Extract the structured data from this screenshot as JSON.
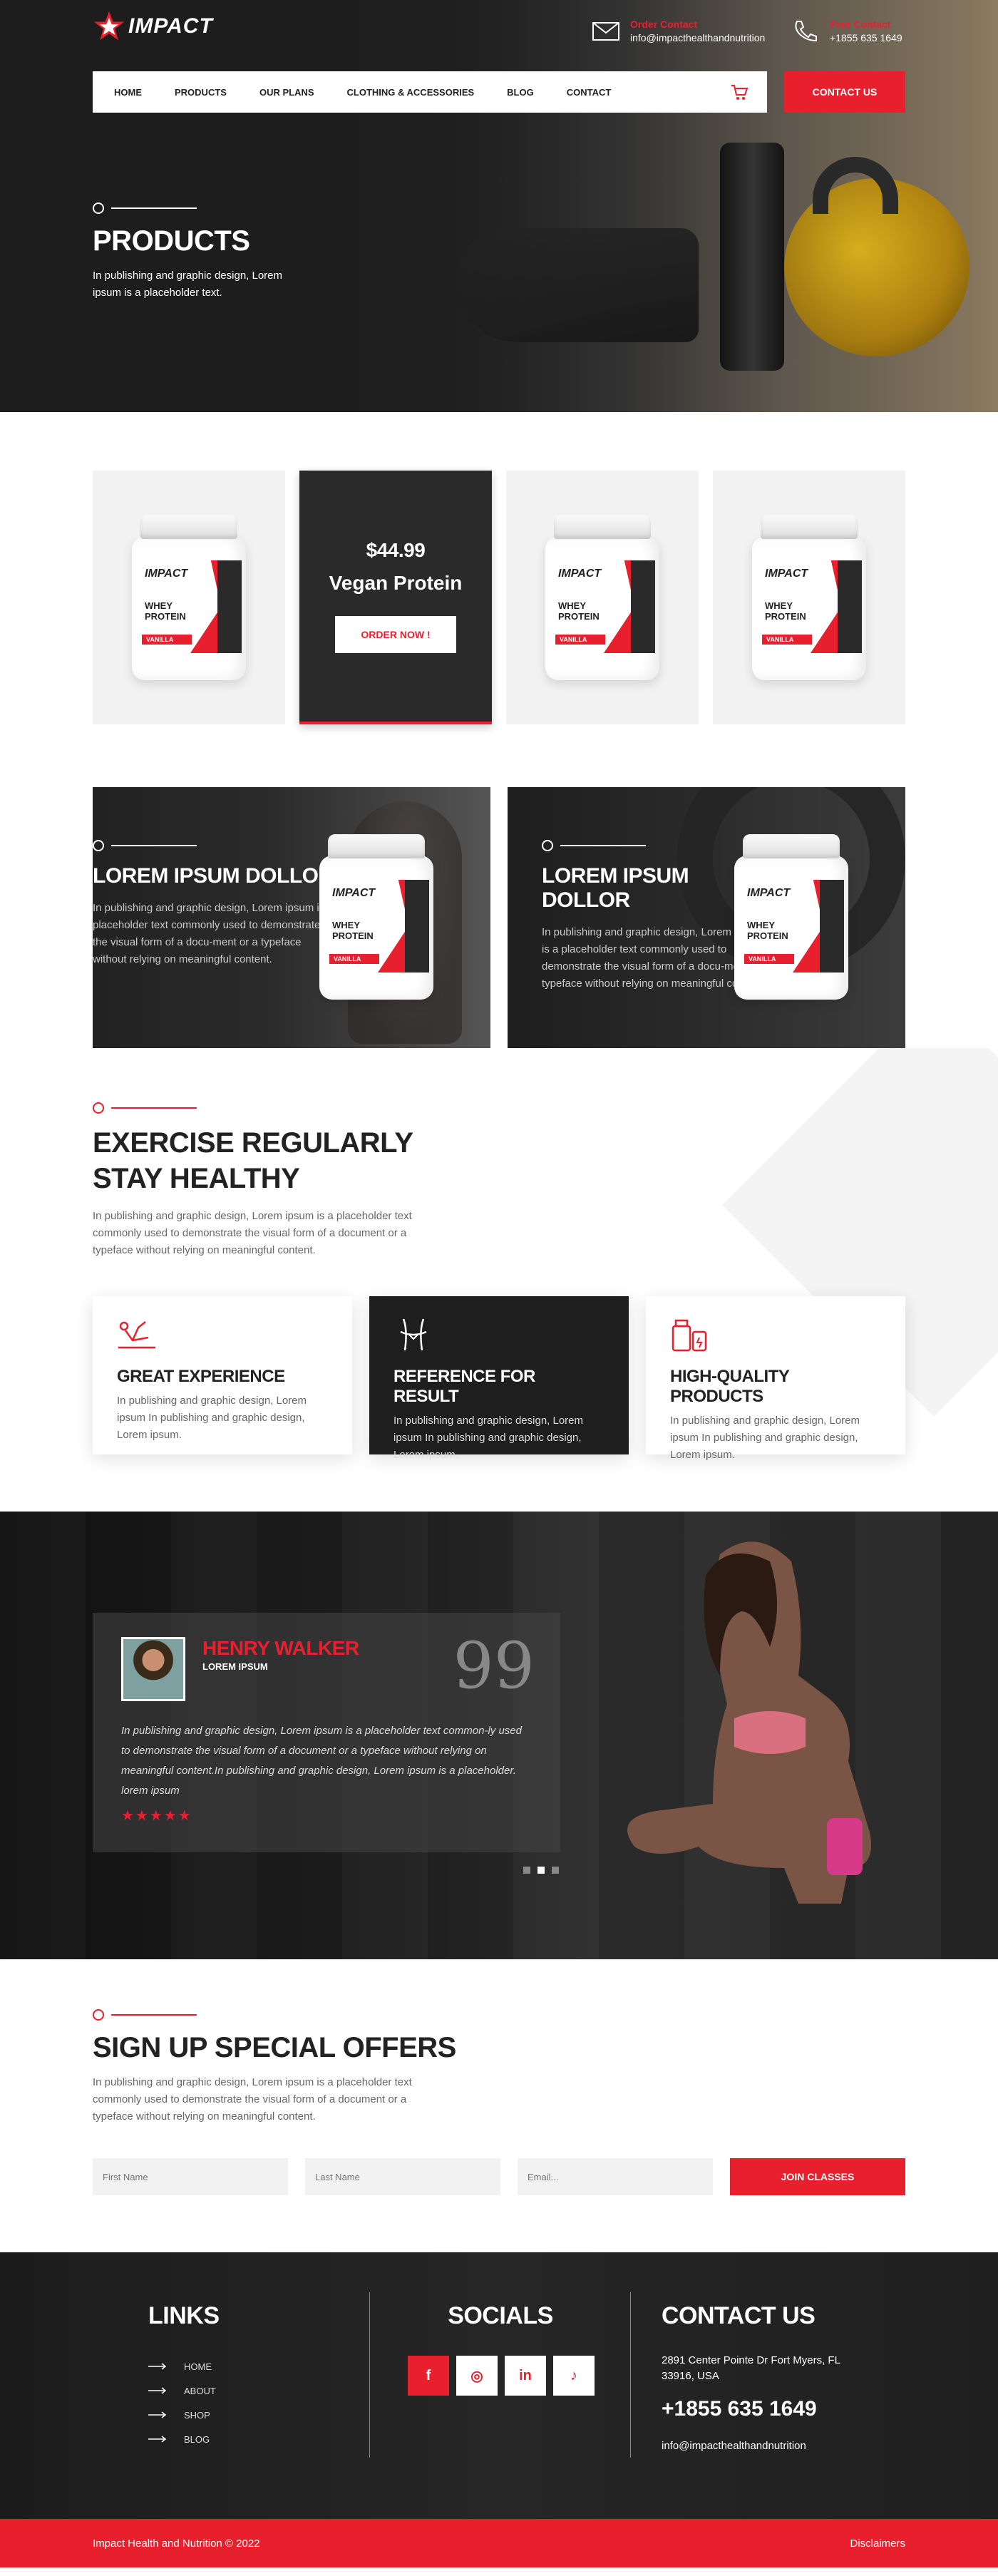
{
  "header": {
    "logo_text": "IMPACT",
    "order_label": "Order Contact",
    "order_email": "info@impacthealthandnutrition",
    "free_label": "Free Contact",
    "free_phone": "+1855 635 1649",
    "nav": [
      "HOME",
      "PRODUCTS",
      "OUR PLANS",
      "CLOTHING & ACCESSORIES",
      "BLOG",
      "CONTACT"
    ],
    "contact_button": "CONTACT US"
  },
  "hero": {
    "title": "PRODUCTS",
    "text": "In publishing and graphic design, Lorem ipsum is a placeholder text."
  },
  "products": {
    "jar_brand": "IMPACT",
    "jar_type": "WHEY PROTEIN",
    "jar_flavor": "VANILLA",
    "featured_price": "$44.99",
    "featured_name": "Vegan Protein",
    "order_button": "ORDER NOW !"
  },
  "features": [
    {
      "title": "LOREM IPSUM DOLLOR",
      "text": "In publishing and graphic design, Lorem ipsum is a placeholder text commonly used to demonstrate the visual form of a docu-ment or a typeface without relying on meaningful content."
    },
    {
      "title": "LOREM IPSUM DOLLOR",
      "text": "In publishing and graphic design, Lorem ipsum is a placeholder text commonly used to demonstrate the visual form of a docu-ment or a typeface without relying on meaningful content."
    }
  ],
  "exercise": {
    "title_line1": "EXERCISE REGULARLY",
    "title_line2": "STAY HEALTHY",
    "text": "In publishing and graphic design, Lorem ipsum is a placeholder text commonly used to demonstrate the visual form of a document or a typeface without relying on meaningful content.",
    "boxes": [
      {
        "icon": "stretching-icon",
        "title": "GREAT EXPERIENCE",
        "text": "In publishing and graphic design, Lorem ipsum In publishing and graphic design, Lorem ipsum."
      },
      {
        "icon": "body-measure-icon",
        "title": "REFERENCE FOR RESULT",
        "text": "In publishing and graphic design, Lorem ipsum In publishing and graphic design, Lorem ipsum."
      },
      {
        "icon": "supplement-icon",
        "title": "HIGH-QUALITY PRODUCTS",
        "text": "In publishing and graphic design, Lorem ipsum In publishing and graphic design, Lorem ipsum."
      }
    ]
  },
  "testimonial": {
    "name": "HENRY WALKER",
    "role": "LOREM IPSUM",
    "quote_mark": "99",
    "text": "In publishing and graphic design, Lorem ipsum is a placeholder text common-ly used to demonstrate the visual form of a document or a typeface without relying on meaningful content.In publishing and graphic design, Lorem ipsum is a placeholder. lorem ipsum",
    "stars": "★★★★★",
    "rating": 5,
    "slides": 3,
    "active_slide": 2
  },
  "signup": {
    "title": "SIGN UP SPECIAL OFFERS",
    "text": "In publishing and graphic design, Lorem ipsum is a placeholder text commonly used to demonstrate the visual form of a document or a typeface without relying on meaningful content.",
    "first_name_placeholder": "First Name",
    "last_name_placeholder": "Last Name",
    "email_placeholder": "Email...",
    "join_button": "JOIN CLASSES"
  },
  "footer": {
    "links_title": "LINKS",
    "links": [
      "HOME",
      "ABOUT",
      "SHOP",
      "BLOG"
    ],
    "socials_title": "SOCIALS",
    "social_icons": [
      "facebook-icon",
      "instagram-icon",
      "linkedin-icon",
      "tiktok-icon"
    ],
    "social_glyphs": [
      "f",
      "◎",
      "in",
      "♪"
    ],
    "contact_title": "CONTACT US",
    "address": "2891 Center Pointe Dr Fort Myers, FL 33916, USA",
    "phone": "+1855 635 1649",
    "email": "info@impacthealthandnutrition"
  },
  "bottom": {
    "copyright": "Impact Health and Nutrition © 2022",
    "disclaimers": "Disclaimers"
  },
  "colors": {
    "accent": "#e8202d",
    "dark": "#1e1e1e"
  }
}
